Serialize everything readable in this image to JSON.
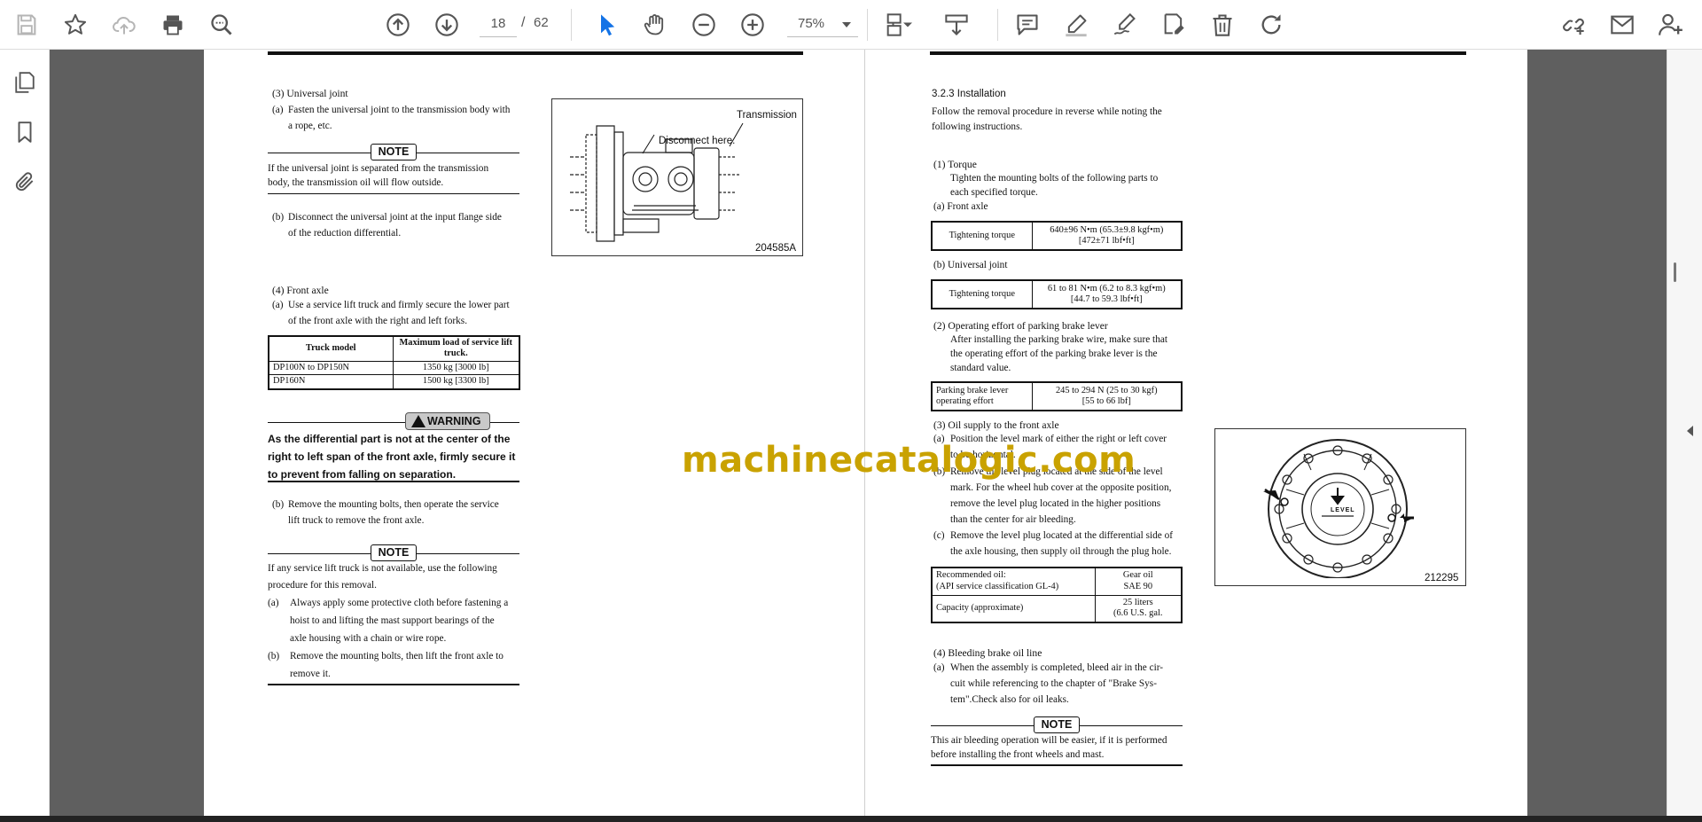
{
  "toolbar": {
    "page_current": "18",
    "page_separator": "/",
    "page_total": "62",
    "zoom": "75%",
    "icons": [
      "save-icon",
      "bookmark-star-icon",
      "cloud-upload-icon",
      "print-icon",
      "zoom-search-icon",
      "page-up-icon",
      "page-down-icon",
      "select-cursor-icon",
      "hand-pan-icon",
      "zoom-out-icon",
      "zoom-in-icon",
      "page-layout-icon",
      "scroll-mode-icon",
      "comment-icon",
      "highlight-pen-icon",
      "draw-signature-icon",
      "stamp-edit-icon",
      "delete-icon",
      "rotate-icon",
      "share-link-icon",
      "email-icon",
      "add-user-icon"
    ]
  },
  "left_rail": {
    "icons": [
      "pages-thumbnail-icon",
      "bookmarks-icon",
      "attachments-icon"
    ]
  },
  "watermark": "machinecatalogic.com",
  "left_page": {
    "s3_heading": "(3)  Universal joint",
    "s3a_label": "(a)",
    "s3a_text_1": "Fasten the universal joint to the transmission body with",
    "s3a_text_2": "a rope, etc.",
    "note_label": "NOTE",
    "note1_text_1": "If the universal joint is separated from the transmission",
    "note1_text_2": "body, the transmission oil will flow outside.",
    "s3b_label": "(b)",
    "s3b_text_1": "Disconnect the universal joint at the input flange side",
    "s3b_text_2": "of the reduction differential.",
    "fig1_label_transmission": "Transmission",
    "fig1_label_disconnect": "Disconnect here.",
    "fig1_code": "204585A",
    "s4_heading": "(4)  Front axle",
    "s4a_label": "(a)",
    "s4a_text_1": "Use a service lift truck and firmly secure the lower part",
    "s4a_text_2": "of the front axle with the right and left forks.",
    "load_table": {
      "headers": [
        "Truck model",
        "Maximum load of service lift truck."
      ],
      "rows": [
        [
          "DP100N to DP150N",
          "1350 kg [3000 lb]"
        ],
        [
          "DP160N",
          "1500 kg [3300 lb]"
        ]
      ]
    },
    "warning_label": "WARNING",
    "warning_text_1": "As the differential part is not at the center of the",
    "warning_text_2": "right to left span of the front axle, firmly secure it",
    "warning_text_3": "to prevent from falling on separation.",
    "s4b_label": "(b)",
    "s4b_text_1": "Remove the mounting bolts, then operate the service",
    "s4b_text_2": "lift truck to remove the front axle.",
    "note2_text_1": "If any service lift truck is not available, use the following",
    "note2_text_2": "procedure for this removal.",
    "note2a_label": "(a)",
    "note2a_text_1": "Always apply some protective cloth before fastening a",
    "note2a_text_2": "hoist to and lifting the mast support bearings of the",
    "note2a_text_3": "axle housing with a chain or wire rope.",
    "note2b_label": "(b)",
    "note2b_text_1": "Remove the mounting bolts, then lift the front axle to",
    "note2b_text_2": "remove it."
  },
  "right_page": {
    "section_heading": "3.2.3   Installation",
    "intro_1": "Follow the removal procedure in reverse while noting the",
    "intro_2": "following instructions.",
    "t1_heading": "(1)  Torque",
    "t1_text_1": "Tighten the mounting bolts of the following parts to",
    "t1_text_2": "each specified torque.",
    "t1a": "(a)  Front axle",
    "torque_label": "Tightening torque",
    "front_axle_torque_1": "640±96 N•m (65.3±9.8 kgf•m)",
    "front_axle_torque_2": "[472±71 lbf•ft]",
    "t1b": "(b)  Universal joint",
    "uj_torque_1": "61 to 81 N•m (6.2 to 8.3 kgf•m)",
    "uj_torque_2": "[44.7 to 59.3 lbf•ft]",
    "t2_heading": "(2)  Operating effort of parking brake lever",
    "t2_text_1": "After installing the parking brake wire, make sure that",
    "t2_text_2": "the operating effort of the parking brake lever is the",
    "t2_text_3": "standard value.",
    "brake_label_1": "Parking brake lever",
    "brake_label_2": "operating effort",
    "brake_value_1": "245 to 294 N (25 to 30 kgf)",
    "brake_value_2": "[55 to 66 lbf]",
    "t3_heading": "(3)  Oil supply to the front axle",
    "t3a_label": "(a)",
    "t3a_text_1": "Position the level mark of either the right or left cover",
    "t3a_text_2": "to be horizontal.",
    "t3b_label": "(b)",
    "t3b_text_1": "Remove the level plug located at the side of the level",
    "t3b_text_2": "mark. For the wheel hub cover at the opposite position,",
    "t3b_text_3": "remove the level plug located in the higher positions",
    "t3b_text_4": "than the center for air bleeding.",
    "t3c_label": "(c)",
    "t3c_text_1": "Remove the level plug located at the differential side of",
    "t3c_text_2": "the axle housing, then supply oil through the plug hole.",
    "oil_label_1": "Recommended oil:",
    "oil_label_2": "(API service classification GL-4)",
    "oil_value_1": "Gear oil",
    "oil_value_2": "SAE 90",
    "cap_label": "Capacity (approximate)",
    "cap_value_1": "25 liters",
    "cap_value_2": "(6.6 U.S. gal.",
    "fig2_level": "LEVEL",
    "fig2_code": "212295",
    "t4_heading": "(4)  Bleeding brake oil line",
    "t4a_label": "(a)",
    "t4a_text_1": "When the assembly is completed, bleed air in the cir-",
    "t4a_text_2": "cuit while referencing to the chapter of \"Brake Sys-",
    "t4a_text_3": "tem\".Check also for oil leaks.",
    "note_label": "NOTE",
    "note3_text_1": "This air bleeding operation will be easier, if it is performed",
    "note3_text_2": "before installing the front wheels and mast."
  }
}
